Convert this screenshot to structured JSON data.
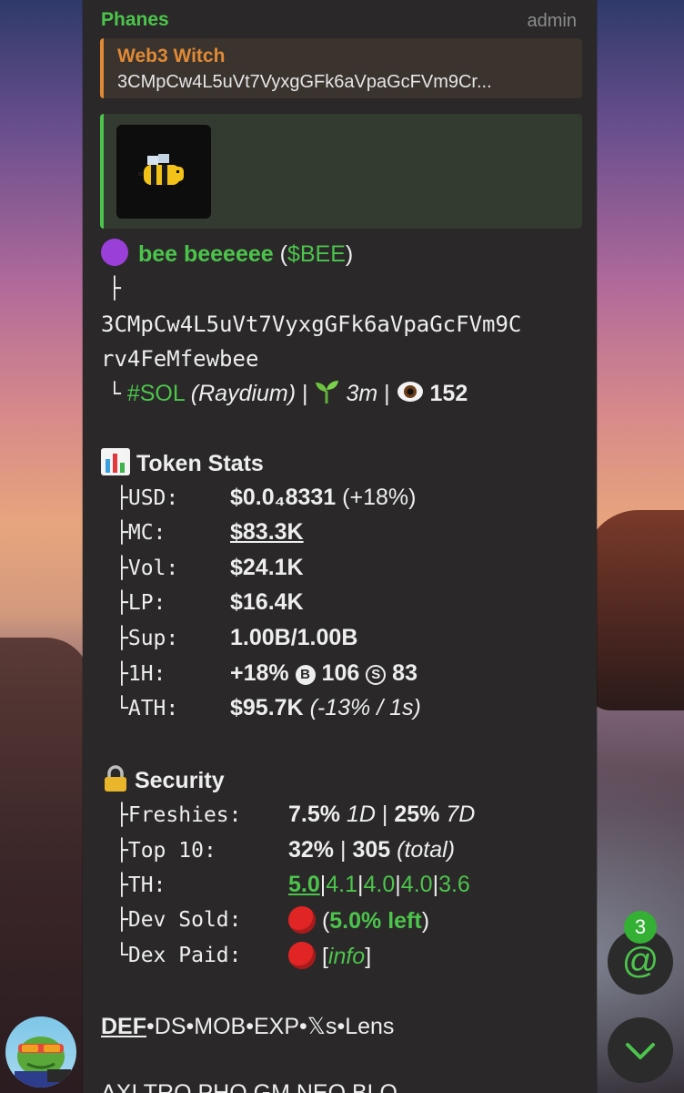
{
  "message": {
    "sender": "Phanes",
    "role": "admin",
    "reply": {
      "name": "Web3 Witch",
      "text": "3CMpCw4L5uVt7VyxgGFk6aVpaGcFVm9Cr..."
    },
    "token": {
      "name": "bee beeeeee",
      "symbol_open": "(",
      "symbol": "$BEE",
      "symbol_close": ")",
      "tree_branch": "├",
      "address_line1": "3CMpCw4L5uVt7VyxgGFk6aVpaGcFVm9C",
      "address_line2": "rv4FeMfewbee",
      "tree_end": "└",
      "chain": "#SOL",
      "dex": "(Raydium)",
      "sep": "|",
      "age": "3m",
      "views": "152"
    },
    "stats": {
      "title": "Token Stats",
      "rows": [
        {
          "prefix": "├",
          "label": "USD:",
          "value": "$0.0₄8331",
          "extra": "(+18%)"
        },
        {
          "prefix": "├",
          "label": "MC:",
          "value": "$83.3K"
        },
        {
          "prefix": "├",
          "label": "Vol:",
          "value": "$24.1K"
        },
        {
          "prefix": "├",
          "label": "LP:",
          "value": "$16.4K"
        },
        {
          "prefix": "├",
          "label": "Sup:",
          "value": "1.00B/1.00B"
        },
        {
          "prefix": "├",
          "label": "1H:",
          "value": "+18%",
          "buys_icon": "B",
          "buys": "106",
          "sells_icon": "S",
          "sells": "83"
        },
        {
          "prefix": "└",
          "label": "ATH:",
          "value": "$95.7K",
          "extra": "(-13% / 1s)"
        }
      ]
    },
    "security": {
      "title": "Security",
      "rows": [
        {
          "prefix": "├",
          "label": "Freshies:",
          "v1": "7.5%",
          "v1i": "1D",
          "sep": "|",
          "v2": "25%",
          "v2i": "7D"
        },
        {
          "prefix": "├",
          "label": "Top 10:",
          "v1": "32%",
          "sep": "|",
          "v2": "305",
          "v2i": "(total)"
        },
        {
          "prefix": "├",
          "label": "TH:",
          "th": [
            "5.0",
            "4.1",
            "4.0",
            "4.0",
            "3.6"
          ]
        },
        {
          "prefix": "├",
          "label": "Dev Sold:",
          "open": "(",
          "link": "5.0% left",
          "close": ")"
        },
        {
          "prefix": "└",
          "label": "Dex Paid:",
          "open": "[",
          "link": "info",
          "close": "]"
        }
      ]
    },
    "links": [
      "DEF",
      "DS",
      "MOB",
      "EXP",
      "𝕏s",
      "Lens"
    ],
    "links_sep": "•",
    "links2_partial": "AXI  TRO  PHO  GM  NEO  BLO"
  },
  "mentions": {
    "count": "3",
    "symbol": "@"
  },
  "colors": {
    "accent": "#4cc44c",
    "reply_accent": "#e08a35",
    "bubble": "#2a2828",
    "alert": "#e12525"
  }
}
